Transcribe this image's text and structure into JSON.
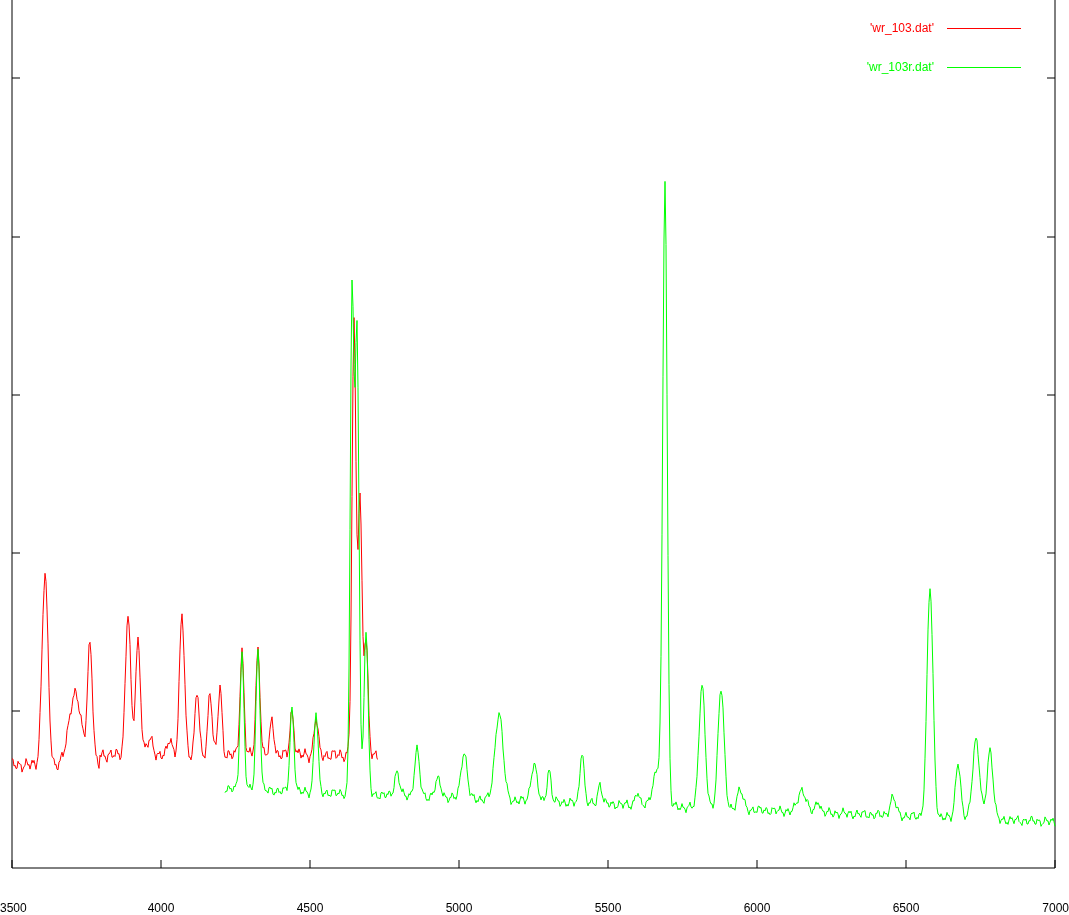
{
  "legend": [
    {
      "label": "'wr_103.dat'",
      "color": "#ff0000"
    },
    {
      "label": "'wr_103r.dat'",
      "color": "#00ff00"
    }
  ],
  "x_tick_labels": [
    "3500",
    "4000",
    "4500",
    "5000",
    "5500",
    "6000",
    "6500",
    "7000"
  ]
}
